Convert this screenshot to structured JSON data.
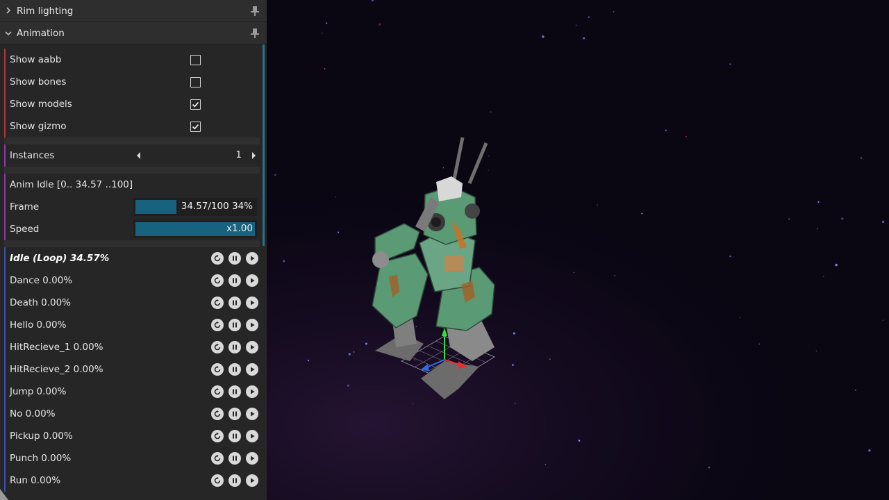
{
  "sections": {
    "rim_lighting": {
      "label": "Rim lighting",
      "expanded": false
    },
    "animation": {
      "label": "Animation",
      "expanded": true
    }
  },
  "options": {
    "show_aabb": {
      "label": "Show aabb",
      "checked": false
    },
    "show_bones": {
      "label": "Show bones",
      "checked": false
    },
    "show_models": {
      "label": "Show models",
      "checked": true
    },
    "show_gizmo": {
      "label": "Show gizmo",
      "checked": true
    }
  },
  "instances": {
    "label": "Instances",
    "value": "1"
  },
  "anim_info": "Anim Idle [0.. 34.57 ..100]",
  "frame": {
    "label": "Frame",
    "text": "34.57/100 34%",
    "progress": 0.3457
  },
  "speed": {
    "label": "Speed",
    "text": "x1.00",
    "progress": 1.0
  },
  "animations": [
    {
      "label": "Idle (Loop) 34.57%",
      "active": true
    },
    {
      "label": "Dance 0.00%",
      "active": false
    },
    {
      "label": "Death 0.00%",
      "active": false
    },
    {
      "label": "Hello 0.00%",
      "active": false
    },
    {
      "label": "HitRecieve_1 0.00%",
      "active": false
    },
    {
      "label": "HitRecieve_2 0.00%",
      "active": false
    },
    {
      "label": "Jump 0.00%",
      "active": false
    },
    {
      "label": "No 0.00%",
      "active": false
    },
    {
      "label": "Pickup 0.00%",
      "active": false
    },
    {
      "label": "Punch 0.00%",
      "active": false
    },
    {
      "label": "Run 0.00%",
      "active": false
    }
  ],
  "colors": {
    "panel_bg": "#262626",
    "accent_bar": "#17627e",
    "stripe_red": "#b03545",
    "stripe_purple": "#8a3aa8",
    "stripe_blue": "#3a4fb0",
    "grid": "#ffffff",
    "robot_green": "#5a9a74"
  },
  "icons": [
    "chevron-right-icon",
    "chevron-down-icon",
    "pin-icon",
    "check-icon",
    "restart-icon",
    "pause-icon",
    "play-icon"
  ]
}
